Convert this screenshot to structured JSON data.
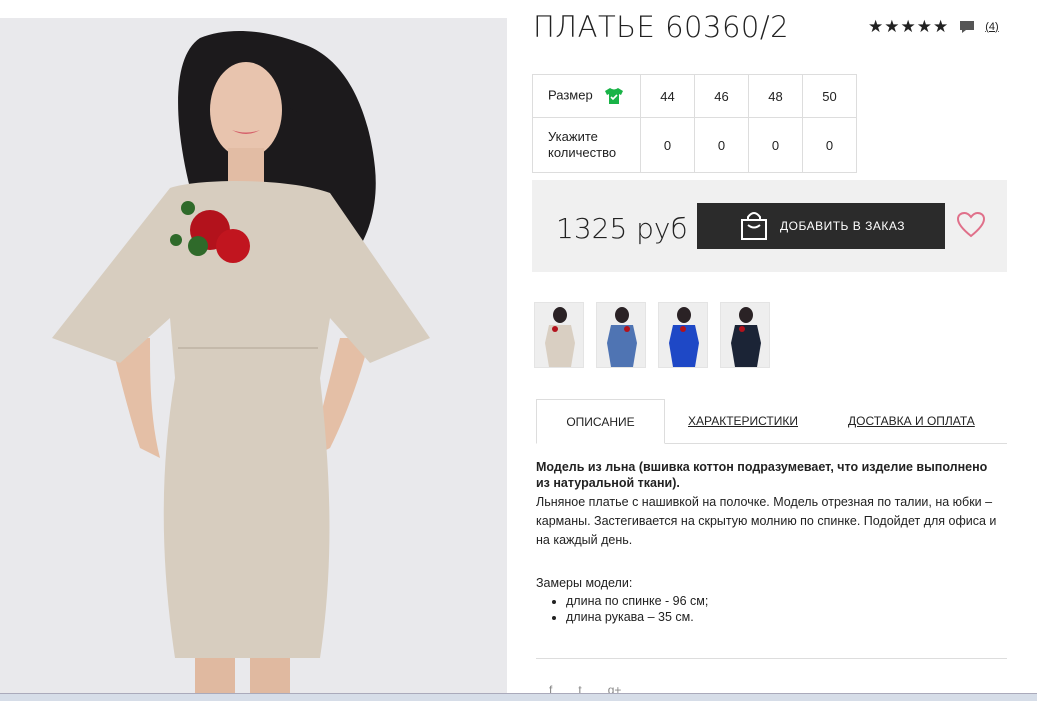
{
  "product": {
    "title": "ПЛАТЬЕ 60360/2",
    "rating_stars": 5,
    "review_count": "(4)"
  },
  "sizes": {
    "size_label": "Размер",
    "qty_label_1": "Укажите",
    "qty_label_2": "количество",
    "values": [
      "44",
      "46",
      "48",
      "50"
    ],
    "quantities": [
      "0",
      "0",
      "0",
      "0"
    ]
  },
  "buy": {
    "price": "1325 руб",
    "add_label": "ДОБАВИТЬ В ЗАКАЗ"
  },
  "tabs": [
    "ОПИСАНИЕ",
    "ХАРАКТЕРИСТИКИ",
    "ДОСТАВКА И ОПЛАТА"
  ],
  "description": {
    "lead": "Модель из льна (вшивка коттон подразумевает, что изделие выполнено из натуральной ткани).",
    "body": "Льняное платье с нашивкой на полочке. Модель отрезная по талии, на юбки – карманы. Застегивается на скрытую молнию по спинке. Подойдет для офиса и на каждый день.",
    "measures_title": "Замеры модели:",
    "measures": [
      "длина по спинке - 96 см;",
      "длина рукава – 35 см."
    ]
  },
  "social": [
    "f",
    "t",
    "g+"
  ],
  "colors": {
    "dark": "#2b2b2b",
    "tshirt_green": "#19b347",
    "heart_pink": "#e0708a",
    "thumb_colors": [
      "#d9cfc2",
      "#4f74b3",
      "#1e48c6",
      "#1b2436"
    ]
  }
}
